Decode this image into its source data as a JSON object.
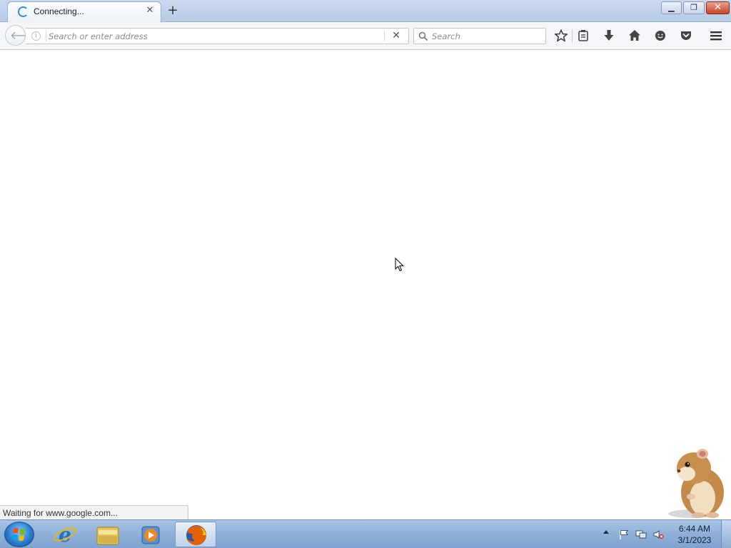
{
  "tab": {
    "title": "Connecting..."
  },
  "navbar": {
    "url_placeholder": "Search or enter address",
    "search_placeholder": "Search"
  },
  "toolbar_icons": [
    "bookmark-star-icon",
    "reading-list-icon",
    "download-icon",
    "home-icon",
    "hello-chat-icon",
    "pocket-icon",
    "hamburger-menu-icon"
  ],
  "status": {
    "text": "Waiting for www.google.com..."
  },
  "taskbar": {
    "apps": [
      "internet-explorer",
      "file-explorer",
      "media-player",
      "firefox"
    ],
    "active_app": "firefox",
    "clock_time": "6:44 AM",
    "clock_date": "3/1/2023"
  },
  "colors": {
    "titlebar": "#c9d9ee",
    "taskbar": "#8eb0d8",
    "close_button": "#c7432a",
    "spinner": "#2b8fe0"
  }
}
